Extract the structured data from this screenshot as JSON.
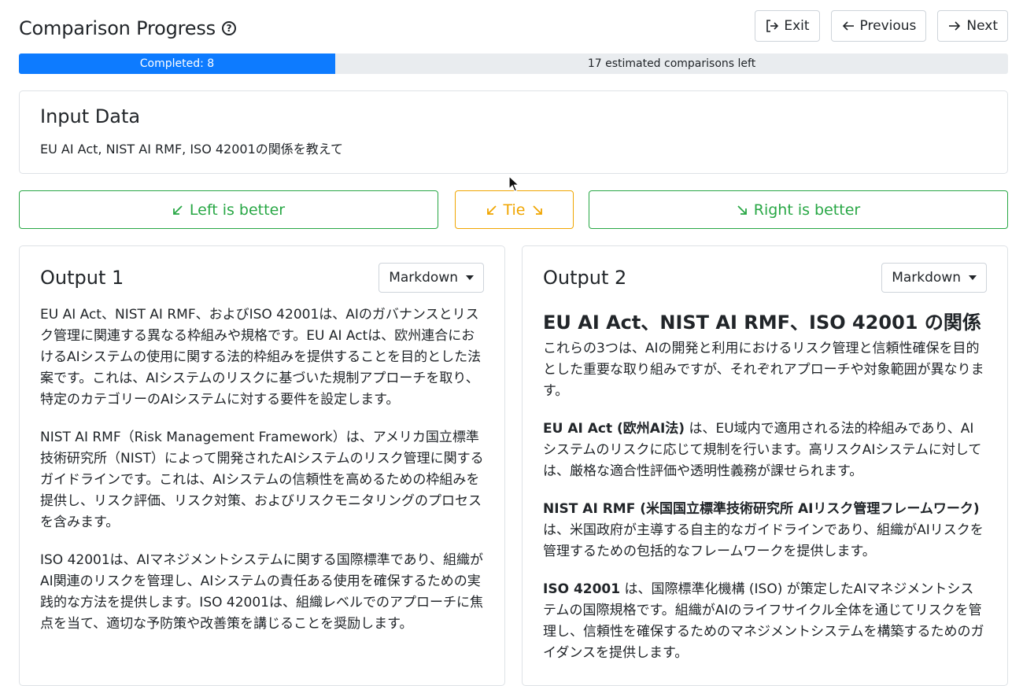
{
  "header": {
    "title": "Comparison Progress",
    "help_icon": "question-circle-icon",
    "buttons": {
      "exit": "Exit",
      "previous": "Previous",
      "next": "Next"
    }
  },
  "progress": {
    "completed_label": "Completed: 8",
    "remaining_label": "17 estimated comparisons left",
    "completed_fraction": 0.32,
    "fill_color": "#0d7bff"
  },
  "input": {
    "heading": "Input Data",
    "text": "EU AI Act, NIST AI RMF, ISO 42001の関係を教えて"
  },
  "choices": {
    "left": "Left is better",
    "tie": "Tie",
    "right": "Right is better"
  },
  "output1": {
    "title": "Output 1",
    "format": "Markdown",
    "paragraphs": [
      "EU AI Act、NIST AI RMF、およびISO 42001は、AIのガバナンスとリスク管理に関連する異なる枠組みや規格です。EU AI Actは、欧州連合におけるAIシステムの使用に関する法的枠組みを提供することを目的とした法案です。これは、AIシステムのリスクに基づいた規制アプローチを取り、特定のカテゴリーのAIシステムに対する要件を設定します。",
      "NIST AI RMF（Risk Management Framework）は、アメリカ国立標準技術研究所（NIST）によって開発されたAIシステムのリスク管理に関するガイドラインです。これは、AIシステムの信頼性を高めるための枠組みを提供し、リスク評価、リスク対策、およびリスクモニタリングのプロセスを含みます。",
      "ISO 42001は、AIマネジメントシステムに関する国際標準であり、組織がAI関連のリスクを管理し、AIシステムの責任ある使用を確保するための実践的な方法を提供します。ISO 42001は、組織レベルでのアプローチに焦点を当て、適切な予防策や改善策を講じることを奨励します。"
    ]
  },
  "output2": {
    "title": "Output 2",
    "format": "Markdown",
    "heading": "EU AI Act、NIST AI RMF、ISO 42001 の関係",
    "intro": "これらの3つは、AIの開発と利用におけるリスク管理と信頼性確保を目的とした重要な取り組みですが、それぞれアプローチや対象範囲が異なります。",
    "items": [
      {
        "bold": "EU AI Act (欧州AI法)",
        "text": " は、EU域内で適用される法的枠組みであり、AIシステムのリスクに応じて規制を行います。高リスクAIシステムに対しては、厳格な適合性評価や透明性義務が課せられます。"
      },
      {
        "bold": "NIST AI RMF (米国国立標準技術研究所 AIリスク管理フレームワーク)",
        "text": " は、米国政府が主導する自主的なガイドラインであり、組織がAIリスクを管理するための包括的なフレームワークを提供します。"
      },
      {
        "bold": "ISO 42001",
        "text": " は、国際標準化機構 (ISO) が策定したAIマネジメントシステムの国際規格です。組織がAIのライフサイクル全体を通じてリスクを管理し、信頼性を確保するためのマネジメントシステムを構築するためのガイダンスを提供します。"
      }
    ]
  }
}
